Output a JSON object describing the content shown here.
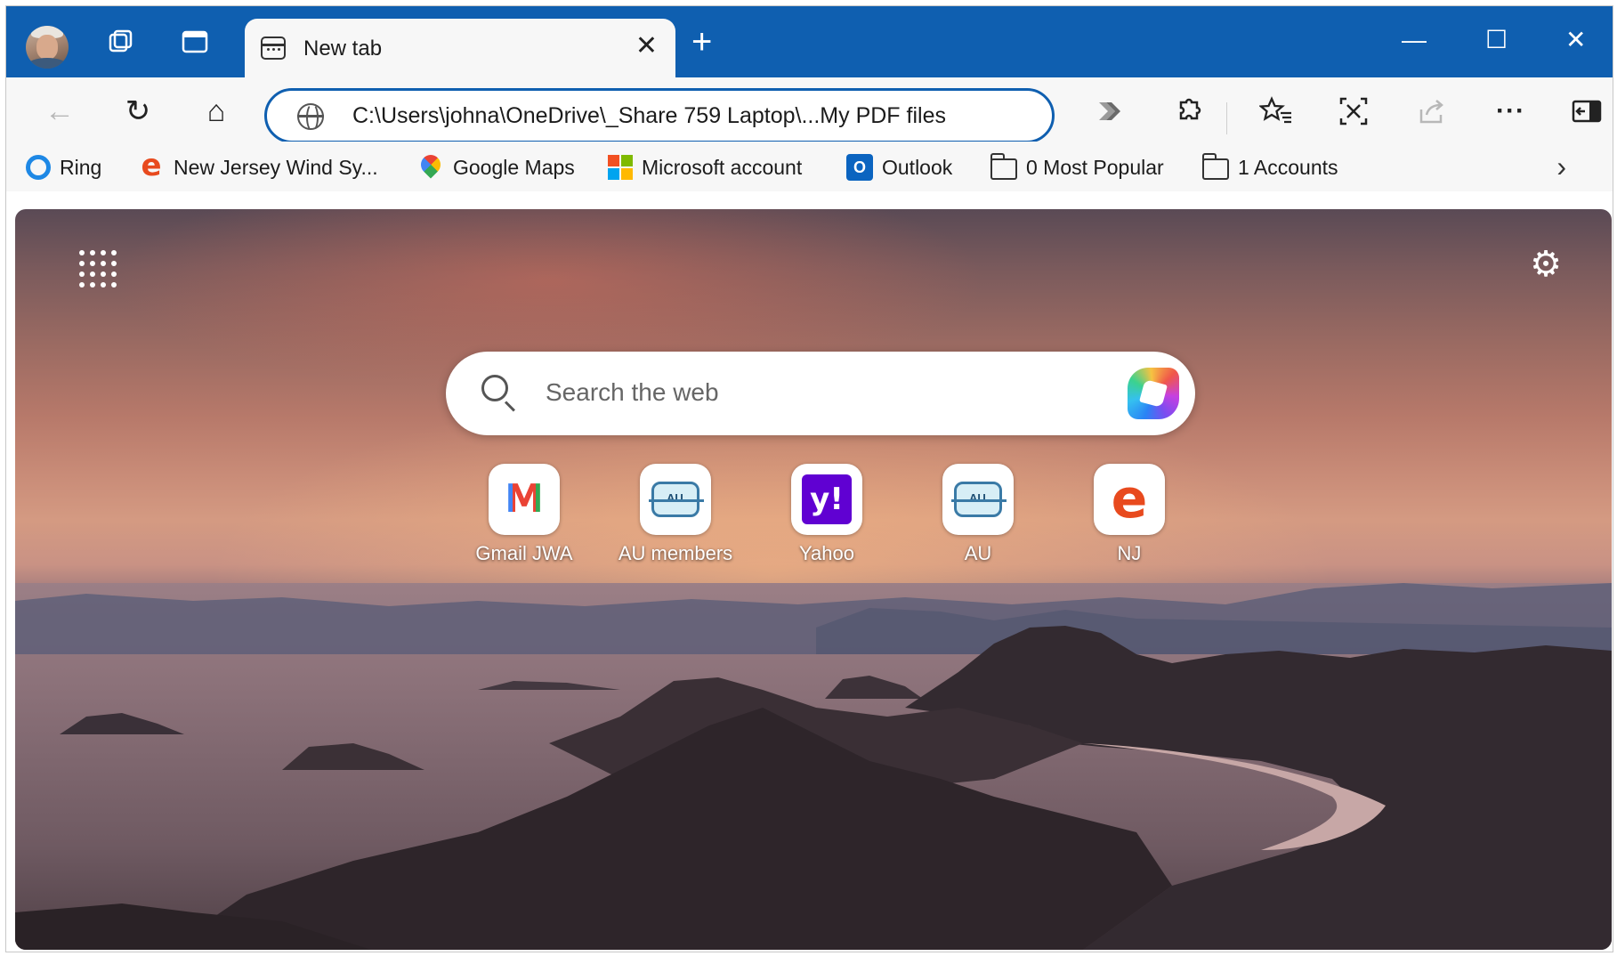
{
  "titlebar": {
    "tab_title": "New tab",
    "tab_close": "✕",
    "new_tab": "+",
    "minimize": "—",
    "maximize": "☐",
    "close": "✕",
    "colors": {
      "frame": "#0f5fb0"
    }
  },
  "toolbar": {
    "back": "←",
    "refresh": "↻",
    "home": "⌂",
    "address_url": "C:\\Users\\johna\\OneDrive\\_Share 759 Laptop\\...My PDF files",
    "more": "···",
    "icons": [
      "back-icon",
      "refresh-icon",
      "home-icon",
      "globe-icon",
      "read-aloud-icon",
      "extensions-icon",
      "favorites-icon",
      "screenshot-icon",
      "share-icon",
      "more-icon",
      "sidebar-icon"
    ]
  },
  "favorites": {
    "items": [
      {
        "label": "Ring",
        "icon": "ring-icon"
      },
      {
        "label": "New Jersey Wind Sy...",
        "icon": "e-icon"
      },
      {
        "label": "Google Maps",
        "icon": "maps-pin-icon"
      },
      {
        "label": "Microsoft account",
        "icon": "microsoft-icon"
      },
      {
        "label": "Outlook",
        "icon": "outlook-icon"
      },
      {
        "label": "0 Most Popular",
        "icon": "folder-icon"
      },
      {
        "label": "1 Accounts",
        "icon": "folder-icon"
      }
    ],
    "more": "›"
  },
  "newtab": {
    "search_placeholder": "Search the web",
    "settings": "⚙",
    "tiles": [
      {
        "label": "Gmail JWA",
        "icon": "gmail-icon"
      },
      {
        "label": "AU members",
        "icon": "au-icon"
      },
      {
        "label": "Yahoo",
        "icon": "yahoo-icon",
        "glyph": "y!"
      },
      {
        "label": "AU",
        "icon": "au-icon"
      },
      {
        "label": "NJ",
        "icon": "e-icon",
        "glyph": "e"
      }
    ]
  }
}
